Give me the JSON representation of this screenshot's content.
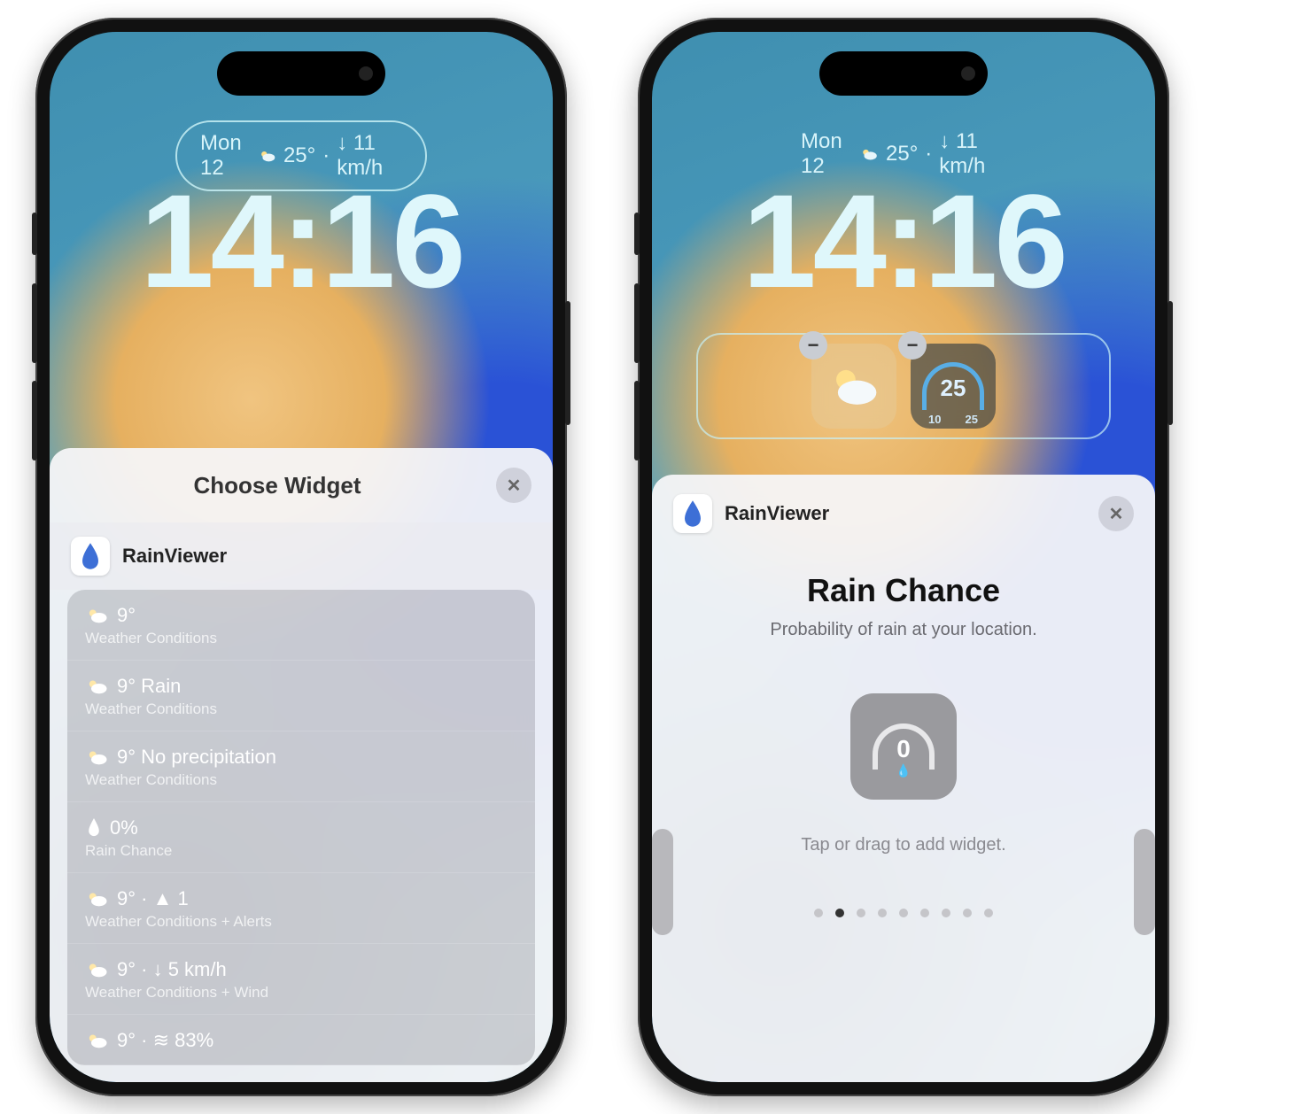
{
  "shared": {
    "date_label": "Mon 12",
    "pill_temp": "25°",
    "pill_wind": "↓ 11 km/h",
    "time": "14:16"
  },
  "left": {
    "sheet_title": "Choose Widget",
    "app_name": "RainViewer",
    "items": [
      {
        "line1": "9°",
        "line2": "Weather Conditions",
        "icon": "cloud"
      },
      {
        "line1": "9° Rain",
        "line2": "Weather Conditions",
        "icon": "cloud"
      },
      {
        "line1": "9° No precipitation",
        "line2": "Weather Conditions",
        "icon": "cloud"
      },
      {
        "line1": "0%",
        "line2": "Rain Chance",
        "icon": "drop"
      },
      {
        "line1": "9° · ▲ 1",
        "line2": "Weather Conditions + Alerts",
        "icon": "cloud"
      },
      {
        "line1": "9° · ↓ 5 km/h",
        "line2": "Weather Conditions + Wind",
        "icon": "cloud"
      },
      {
        "line1": "9° · ≋ 83%",
        "line2": "",
        "icon": "cloud"
      }
    ]
  },
  "right": {
    "app_name": "RainViewer",
    "detail_title": "Rain Chance",
    "detail_sub": "Probability of rain at your location.",
    "preview_value": "0",
    "hint": "Tap or drag to add widget.",
    "page_count": 9,
    "page_active": 1,
    "gauge_value": "25",
    "gauge_min": "10",
    "gauge_max": "25"
  }
}
